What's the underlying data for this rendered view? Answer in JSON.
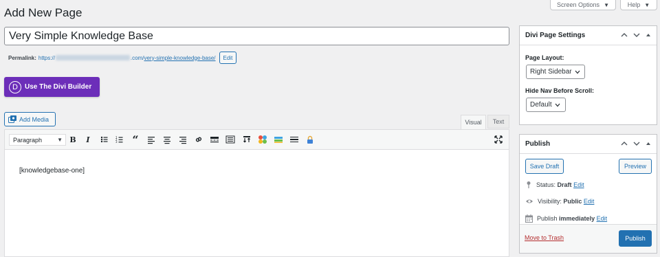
{
  "screen_meta": {
    "screen_options": "Screen Options",
    "help": "Help"
  },
  "page_title": "Add New Page",
  "post_title": "Very Simple Knowledge Base",
  "permalink": {
    "label": "Permalink:",
    "prefix": "https://",
    "domain_suffix": ".com/",
    "slug": "very-simple-knowledge-base/",
    "edit": "Edit"
  },
  "divi_button": {
    "logo": "D",
    "label": "Use The Divi Builder"
  },
  "add_media": "Add Media",
  "editor_tabs": {
    "visual": "Visual",
    "text": "Text"
  },
  "toolbar": {
    "format": "Paragraph",
    "icons": [
      "bold-icon",
      "italic-icon",
      "bullet-list-icon",
      "numbered-list-icon",
      "blockquote-icon",
      "align-left-icon",
      "align-center-icon",
      "align-right-icon",
      "link-icon",
      "read-more-icon",
      "toolbar-toggle-icon",
      "shortcode-icon",
      "colors-icon",
      "layout-icon",
      "divider-icon",
      "lock-icon",
      "fullscreen-icon"
    ]
  },
  "editor_content": "[knowledgebase-one]",
  "divi_settings": {
    "title": "Divi Page Settings",
    "page_layout_label": "Page Layout:",
    "page_layout_value": "Right Sidebar",
    "hide_nav_label": "Hide Nav Before Scroll:",
    "hide_nav_value": "Default"
  },
  "publish": {
    "title": "Publish",
    "save_draft": "Save Draft",
    "preview": "Preview",
    "status_label": "Status:",
    "status_value": "Draft",
    "visibility_label": "Visibility:",
    "visibility_value": "Public",
    "publish_label": "Publish",
    "publish_value": "immediately",
    "edit": "Edit",
    "move_to_trash": "Move to Trash",
    "publish_button": "Publish"
  },
  "colors": {
    "accent": "#2271b1",
    "divi": "#6c2eb9",
    "danger": "#b32d2e"
  }
}
